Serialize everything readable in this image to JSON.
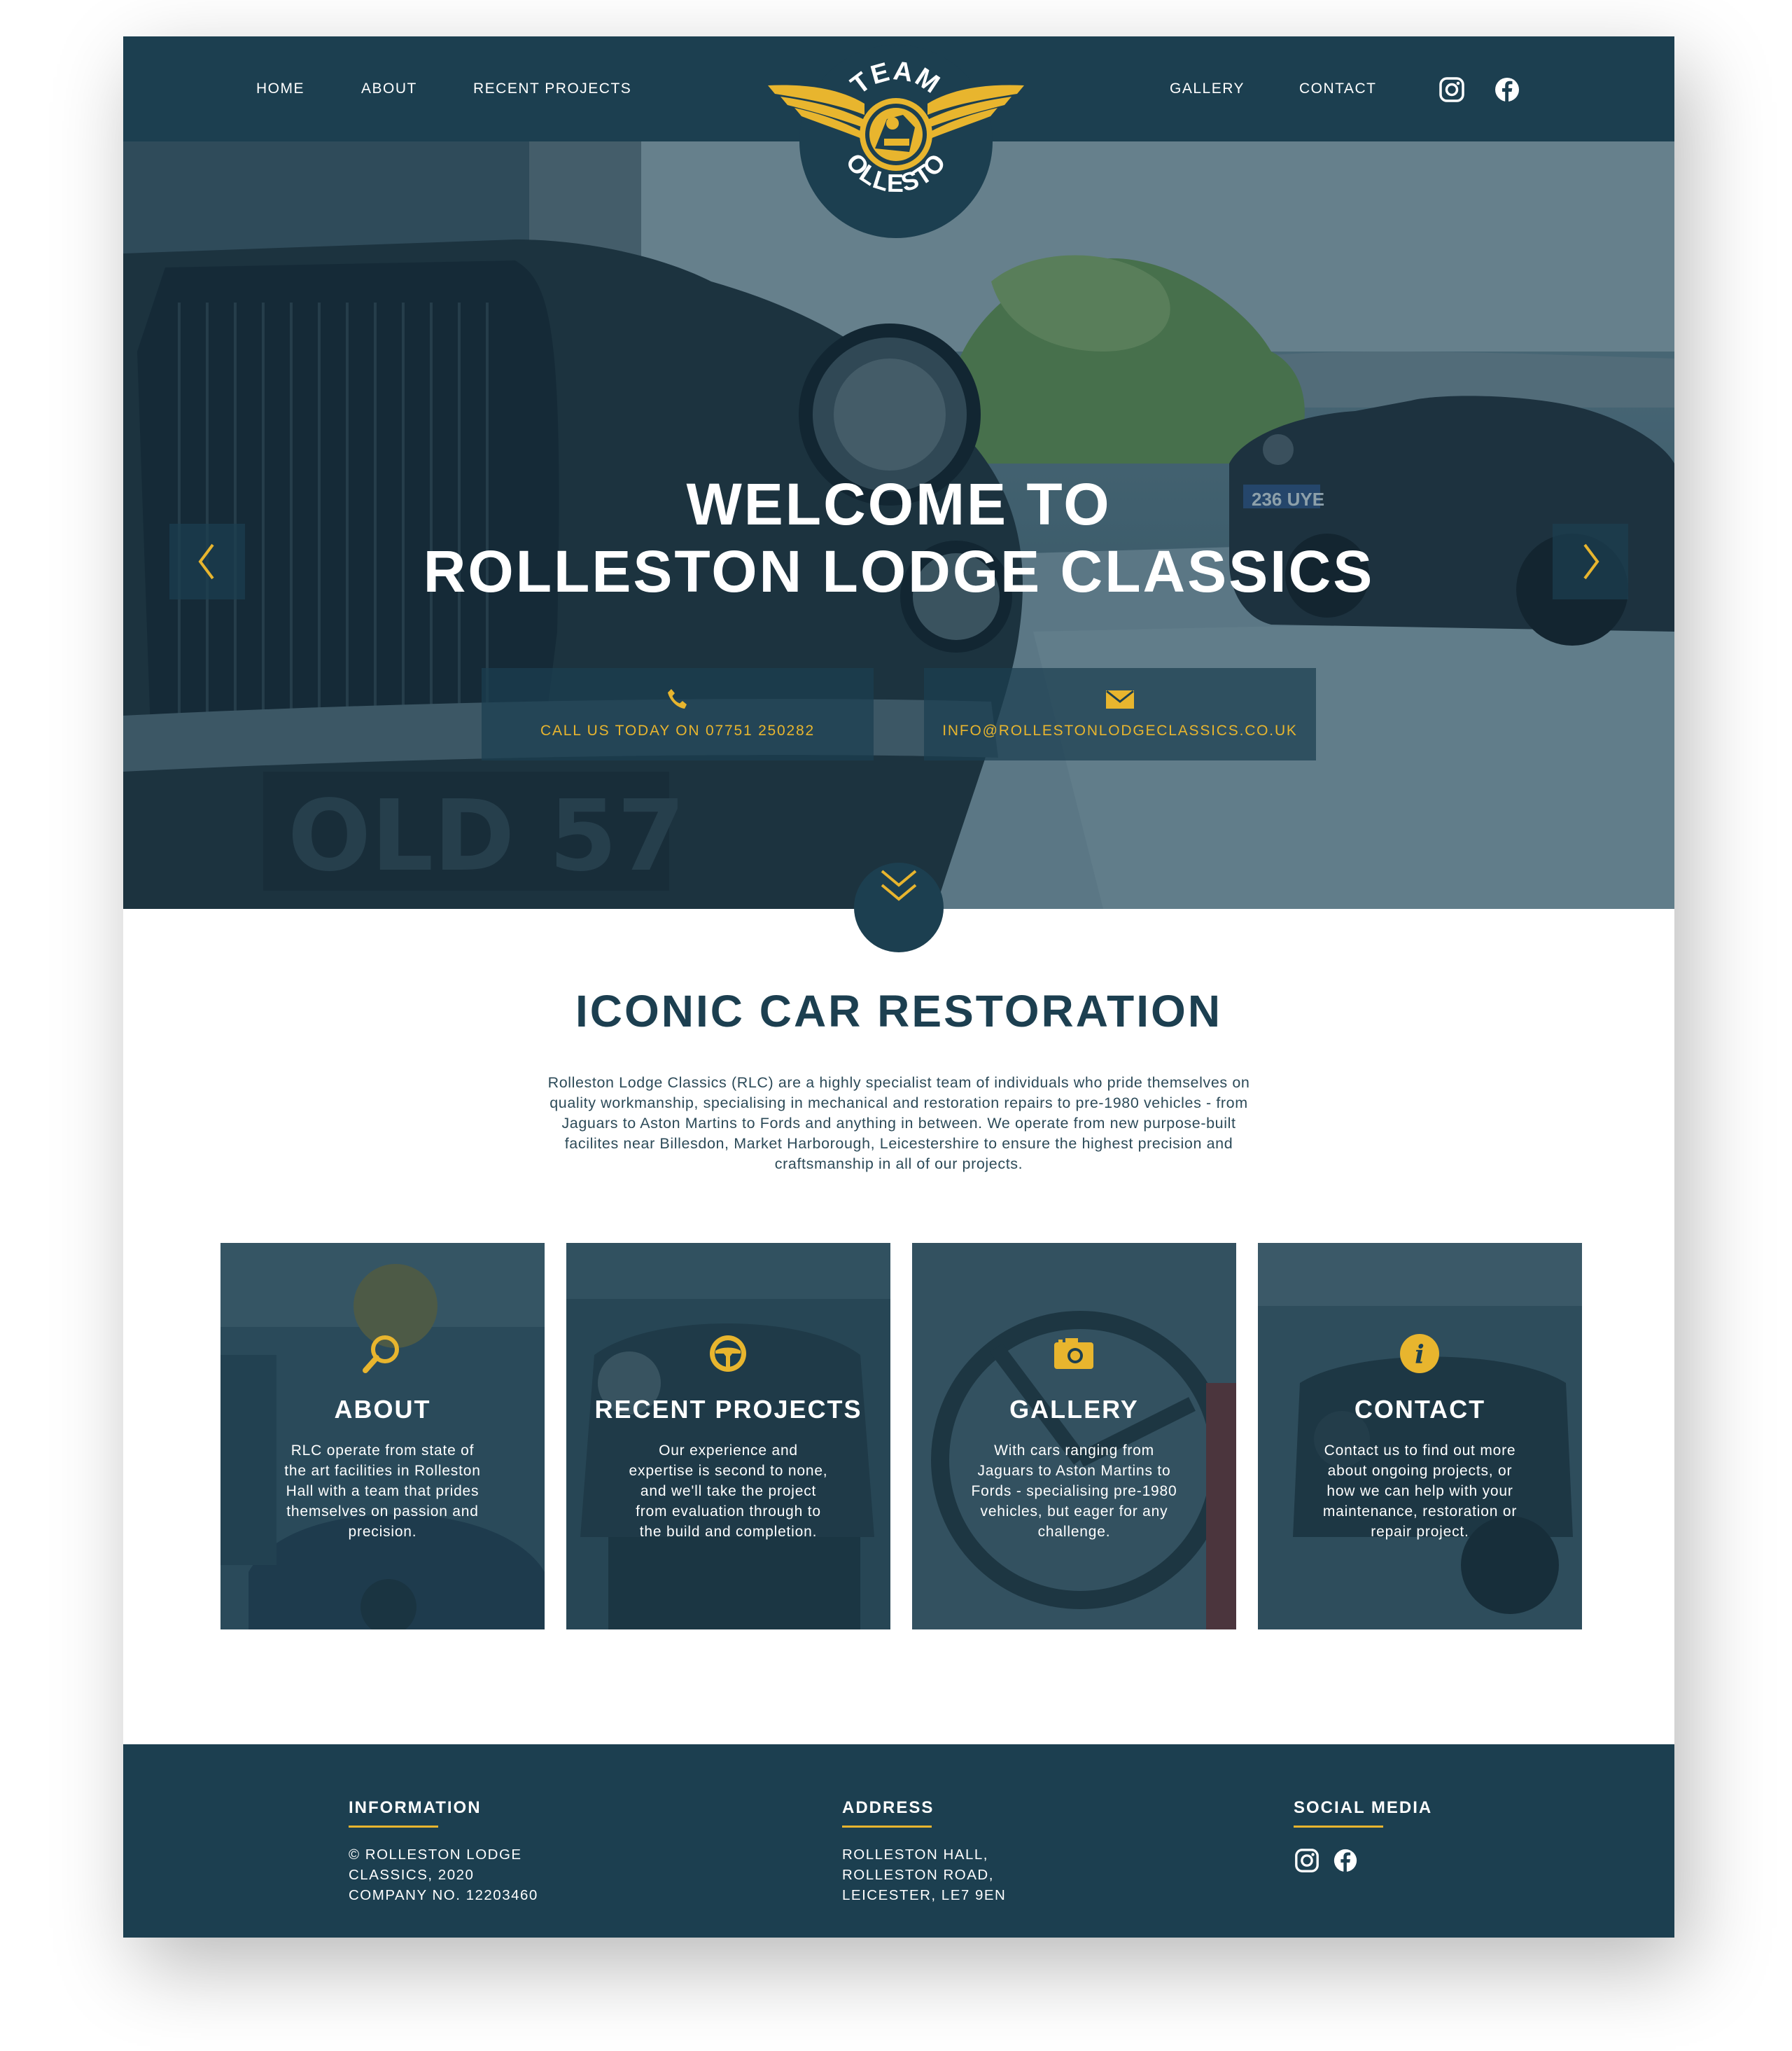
{
  "nav": {
    "left_links": [
      "HOME",
      "ABOUT",
      "RECENT PROJECTS"
    ],
    "right_links": [
      "GALLERY",
      "CONTACT"
    ],
    "social_icons": [
      "instagram-icon",
      "facebook-icon"
    ],
    "logo": {
      "top_text": "TEAM",
      "bottom_text": "ROLLESTON"
    }
  },
  "hero": {
    "title_line1": "WELCOME TO",
    "title_line2": "ROLLESTON LODGE CLASSICS",
    "plate_text": "OLD 57",
    "plate_text_2": "236 UYE",
    "prev_icon": "chevron-left-icon",
    "next_icon": "chevron-right-icon",
    "cta_phone": {
      "icon": "phone-icon",
      "label": "CALL US TODAY ON 07751 250282"
    },
    "cta_email": {
      "icon": "envelope-icon",
      "label": "INFO@ROLLESTONLODGECLASSICS.CO.UK"
    },
    "scroll_icon": "double-chevron-down-icon"
  },
  "intro": {
    "title": "ICONIC CAR RESTORATION",
    "lines": [
      "Rolleston Lodge Classics (RLC) are a highly specialist team of individuals who pride themselves on",
      "quality workmanship, specialising in mechanical and restoration repairs to pre-1980 vehicles - from",
      "Jaguars to Aston Martins to Fords and anything in between. We operate from new purpose-built",
      "facilites near Billesdon, Market Harborough, Leicestershire to ensure the highest precision and",
      "craftsmanship in all of our projects."
    ]
  },
  "cards": [
    {
      "icon": "magnifier-icon",
      "title": "ABOUT",
      "lines": [
        "RLC operate from state of",
        "the art facilities in Rolleston",
        "Hall with a team that prides",
        "themselves on passion and",
        "precision."
      ]
    },
    {
      "icon": "steering-wheel-icon",
      "title": "RECENT PROJECTS",
      "lines": [
        "Our experience and",
        "expertise is second to none,",
        "and we'll take the project",
        "from evaluation through to",
        "the build and completion."
      ]
    },
    {
      "icon": "camera-icon",
      "title": "GALLERY",
      "lines": [
        "With cars ranging from",
        "Jaguars to Aston Martins to",
        "Fords - specialising pre-1980",
        "vehicles, but eager for any",
        "challenge."
      ]
    },
    {
      "icon": "info-icon",
      "title": "CONTACT",
      "lines": [
        "Contact us to find out more",
        "about ongoing projects, or",
        "how we can help with your",
        "maintenance, restoration or",
        "repair project."
      ]
    }
  ],
  "footer": {
    "information": {
      "heading": "INFORMATION",
      "lines": [
        "© ROLLESTON LODGE",
        "CLASSICS, 2020",
        "COMPANY NO. 12203460"
      ]
    },
    "address": {
      "heading": "ADDRESS",
      "lines": [
        "ROLLESTON HALL,",
        "ROLLESTON ROAD,",
        "LEICESTER, LE7 9EN"
      ]
    },
    "social": {
      "heading": "SOCIAL MEDIA",
      "icons": [
        "instagram-icon",
        "facebook-icon"
      ]
    }
  },
  "colors": {
    "navy": "#1c3f50",
    "gold": "#e8b52e",
    "white": "#ffffff"
  }
}
